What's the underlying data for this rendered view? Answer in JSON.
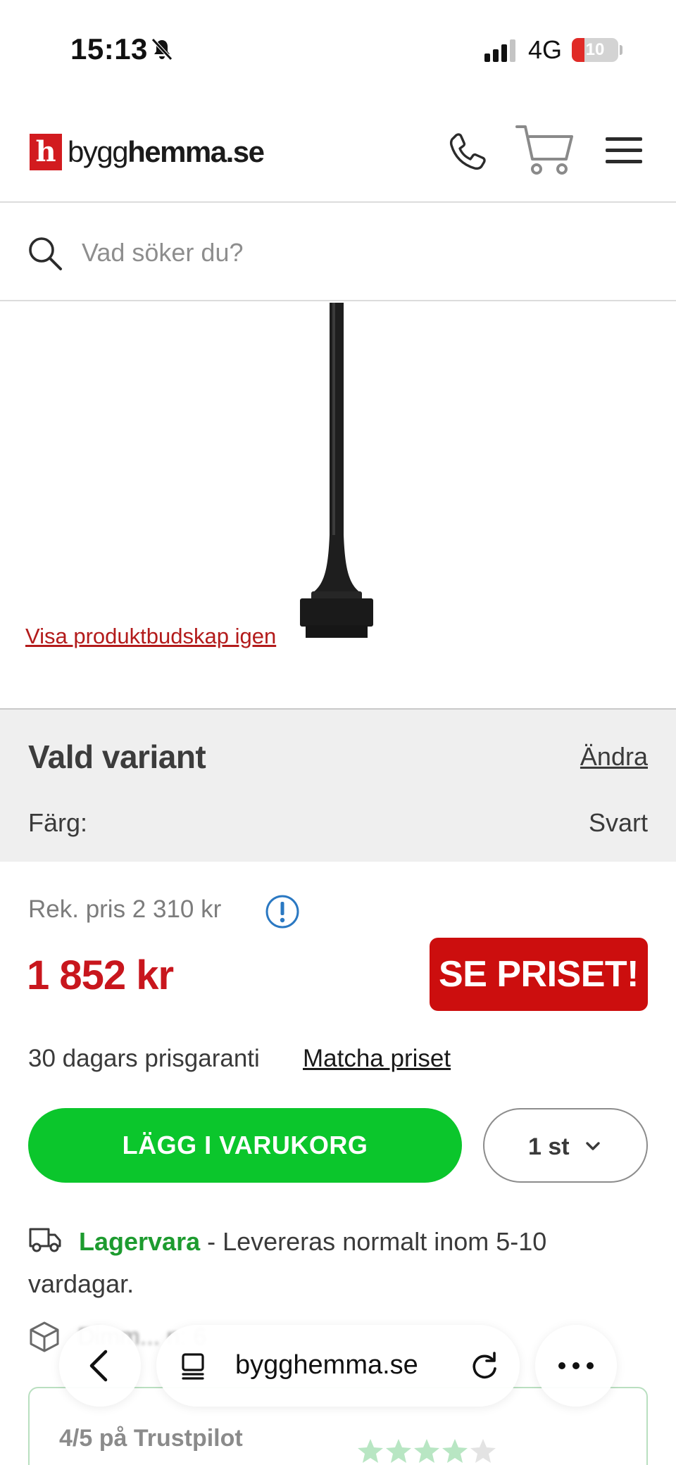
{
  "status_bar": {
    "time": "15:13",
    "network": "4G",
    "battery": "10"
  },
  "header": {
    "logo_letter": "h",
    "logo_part1": "bygg",
    "logo_part2": "hemma.se"
  },
  "search": {
    "placeholder": "Vad söker du?"
  },
  "product": {
    "show_message_link": "Visa produktbudskap igen"
  },
  "variant": {
    "title": "Vald variant",
    "change_link": "Ändra",
    "color_label": "Färg:",
    "color_value": "Svart"
  },
  "pricing": {
    "recommended": "Rek. pris 2 310 kr",
    "price": "1 852 kr",
    "se_priset_button": "SE PRISET!",
    "guarantee_text": "30 dagars prisgaranti",
    "match_link": "Matcha priset"
  },
  "actions": {
    "add_to_cart": "LÄGG I VARUKORG",
    "quantity": "1 st"
  },
  "delivery": {
    "stock_label": "Lagervara",
    "text": " - Levereras normalt inom 5-10 vardagar.",
    "blurred_row": "Dimm... n: 6"
  },
  "trustpilot": {
    "text": "4/5 på Trustpilot",
    "rating": 4
  },
  "browser": {
    "url": "bygghemma.se"
  },
  "colors": {
    "brand_red": "#d21b1f",
    "price_red": "#c8161d",
    "button_green": "#0bc62c",
    "stock_green": "#1d9b2f",
    "info_blue": "#2a78c2"
  }
}
